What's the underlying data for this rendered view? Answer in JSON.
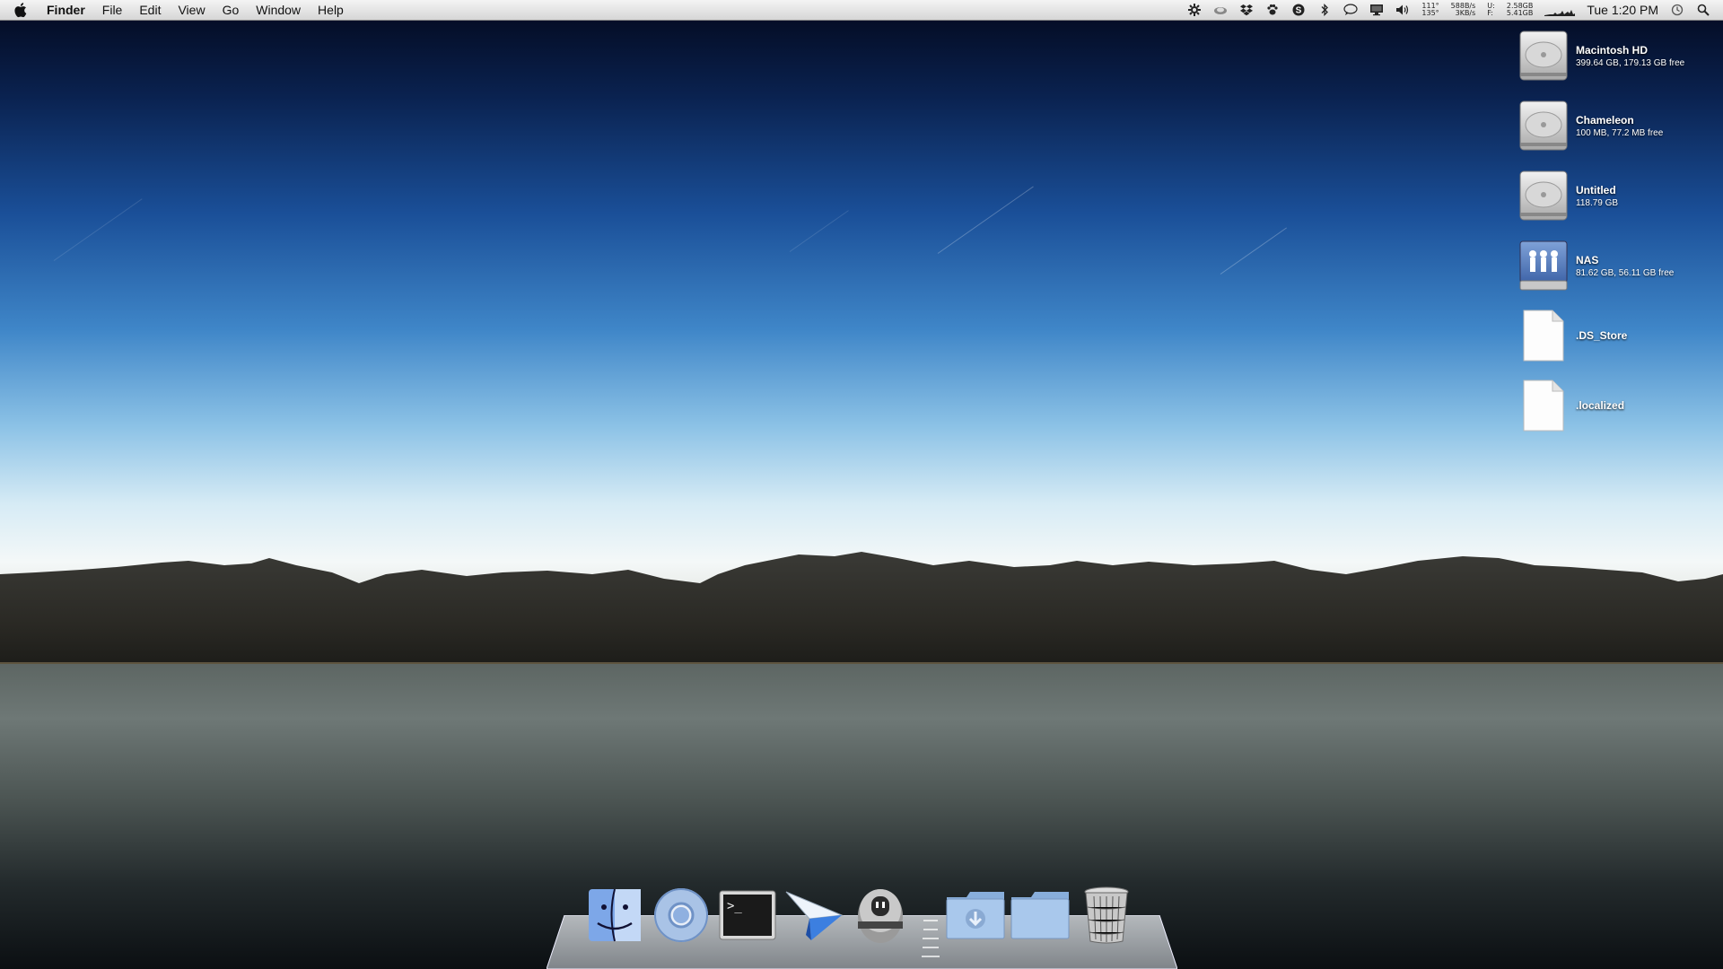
{
  "menubar": {
    "app_name": "Finder",
    "menus": [
      "File",
      "Edit",
      "View",
      "Go",
      "Window",
      "Help"
    ],
    "stats": {
      "temps": [
        "111°",
        "135°"
      ],
      "network": [
        "588B/s",
        "3KB/s"
      ],
      "memory_labels": [
        "U:",
        "F:"
      ],
      "memory": [
        "2.58GB",
        "5.41GB"
      ]
    },
    "clock": "Tue 1:20 PM"
  },
  "desktop_icons": [
    {
      "name": "Macintosh HD",
      "info": "399.64 GB, 179.13 GB free",
      "icon": "hard-drive-icon"
    },
    {
      "name": "Chameleon",
      "info": "100 MB, 77.2 MB free",
      "icon": "hard-drive-icon"
    },
    {
      "name": "Untitled",
      "info": "118.79 GB",
      "icon": "hard-drive-icon"
    },
    {
      "name": "NAS",
      "info": "81.62 GB, 56.11 GB free",
      "icon": "network-share-icon"
    },
    {
      "name": ".DS_Store",
      "info": "",
      "icon": "document-icon"
    },
    {
      "name": ".localized",
      "info": "",
      "icon": "document-icon"
    }
  ],
  "dock": {
    "items": [
      "finder-icon",
      "chrome-icon",
      "terminal-icon",
      "sparrow-mail-icon",
      "alfred-icon",
      "downloads-folder-icon",
      "documents-folder-icon",
      "trash-icon"
    ]
  }
}
